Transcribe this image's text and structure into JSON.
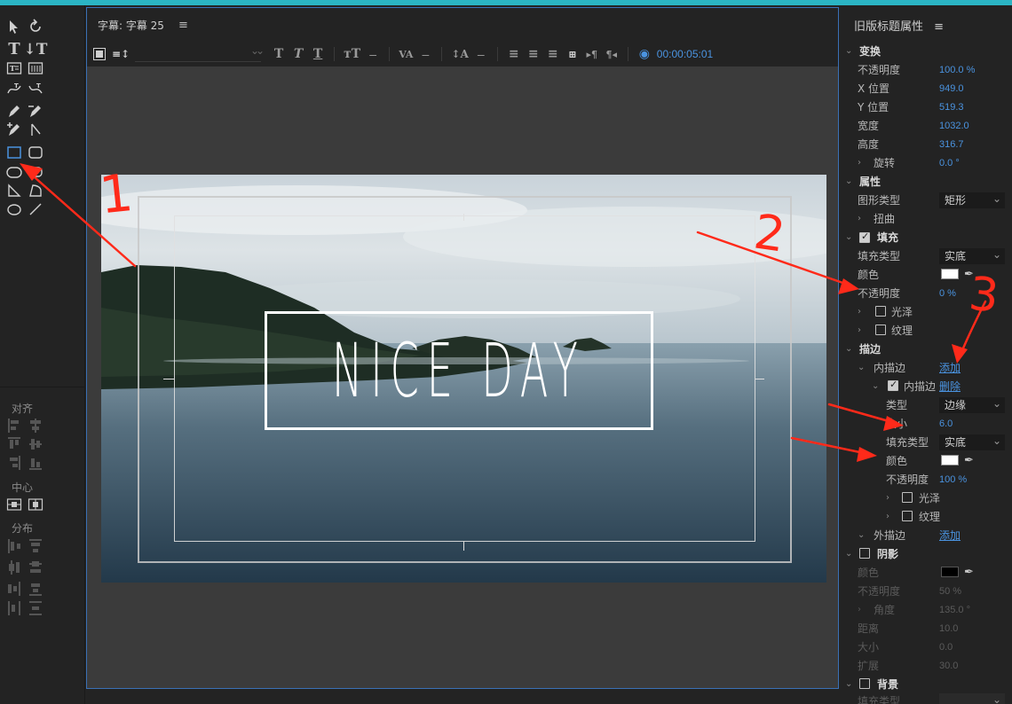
{
  "title_window": {
    "title": "字幕: 字幕 25",
    "menu_icon": "hamburger-icon",
    "timecode": "00:00:05:01"
  },
  "canvas": {
    "main_text": "NICE DAY"
  },
  "tools_panel": {
    "align_label": "对齐",
    "center_label": "中心",
    "distribute_label": "分布"
  },
  "properties": {
    "title": "旧版标题属性",
    "transform": {
      "header": "变换",
      "opacity_label": "不透明度",
      "opacity": "100.0 %",
      "x_label": "X 位置",
      "x": "949.0",
      "y_label": "Y 位置",
      "y": "519.3",
      "width_label": "宽度",
      "width": "1032.0",
      "height_label": "高度",
      "height": "316.7",
      "rotation_label": "旋转",
      "rotation": "0.0 °"
    },
    "attributes": {
      "header": "属性",
      "shape_type_label": "图形类型",
      "shape_type": "矩形",
      "distort_label": "扭曲"
    },
    "fill": {
      "header": "填充",
      "fill_type_label": "填充类型",
      "fill_type": "实底",
      "color_label": "颜色",
      "color": "#ffffff",
      "opacity_label": "不透明度",
      "opacity": "0 %",
      "sheen_label": "光泽",
      "texture_label": "纹理"
    },
    "stroke": {
      "header": "描边",
      "inner_label": "内描边",
      "add_label": "添加",
      "inner_item_label": "内描边",
      "delete_label": "删除",
      "type_label": "类型",
      "type": "边缘",
      "size_label": "大小",
      "size": "6.0",
      "fill_type_label": "填充类型",
      "fill_type": "实底",
      "color_label": "颜色",
      "color": "#ffffff",
      "opacity_label": "不透明度",
      "opacity": "100 %",
      "sheen_label": "光泽",
      "texture_label": "纹理",
      "outer_label": "外描边",
      "outer_add_label": "添加"
    },
    "shadow": {
      "header": "阴影",
      "color_label": "颜色",
      "color": "#000000",
      "opacity_label": "不透明度",
      "opacity": "50 %",
      "angle_label": "角度",
      "angle": "135.0 °",
      "distance_label": "距离",
      "distance": "10.0",
      "size_label": "大小",
      "size": "0.0",
      "spread_label": "扩展",
      "spread": "30.0"
    },
    "background": {
      "header": "背景",
      "fill_type_label": "填充类型"
    }
  },
  "annotations": {
    "mark1": "1",
    "mark2": "2",
    "mark3": "3",
    "color": "#ff2a1a"
  }
}
